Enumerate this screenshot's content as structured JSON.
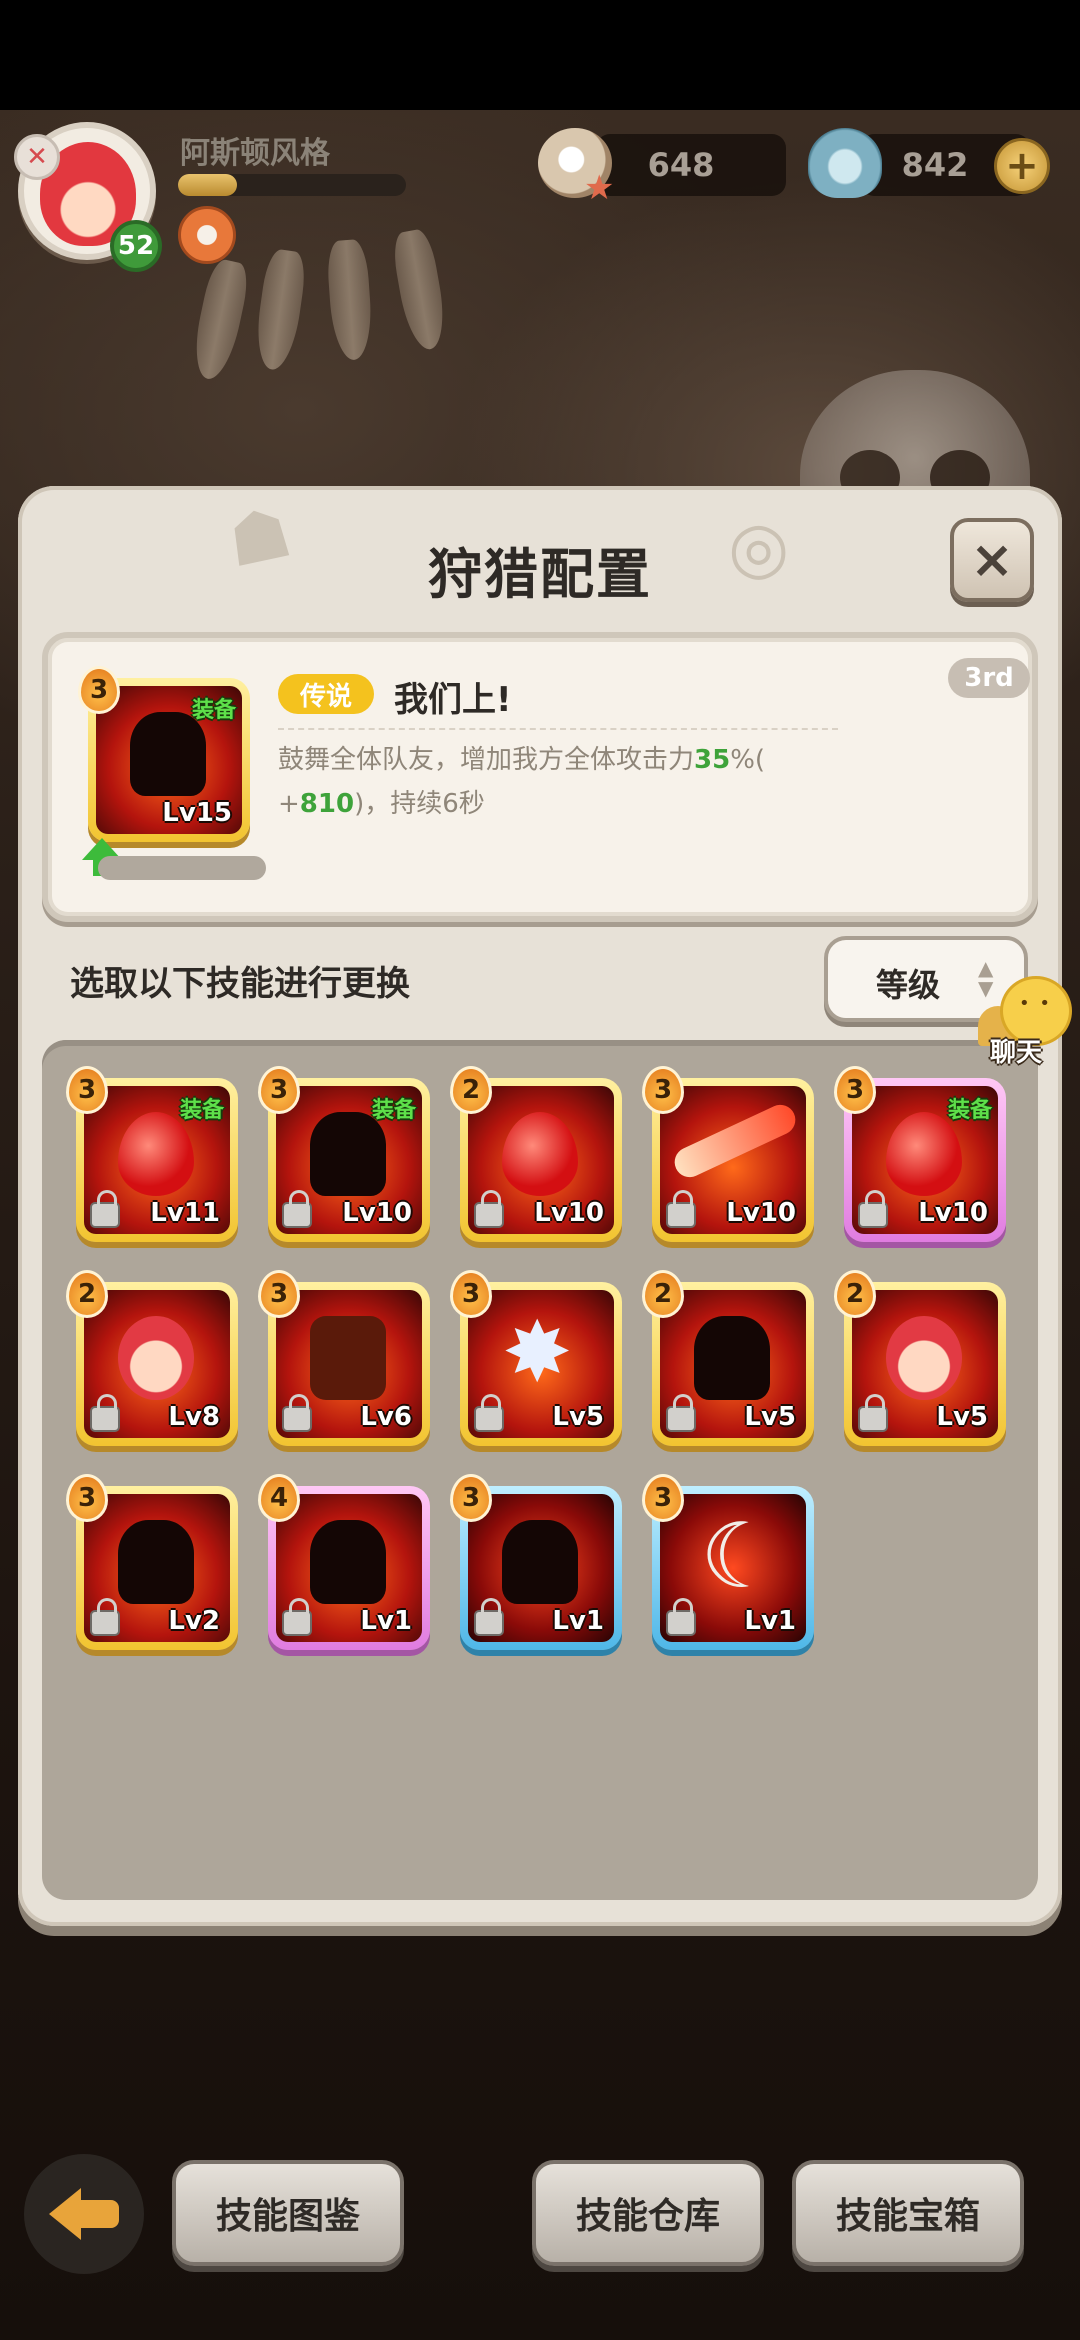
{
  "player": {
    "name": "阿斯顿风格",
    "level": "52",
    "xp_fraction": 0.26
  },
  "currencies": {
    "pearls": "648",
    "gems": "842",
    "add_label": "+"
  },
  "modal": {
    "title": "狩猎配置",
    "close_label": "×",
    "current_skill": {
      "cost": "3",
      "equipped_label": "装备",
      "level": "Lv15",
      "rank": "3rd",
      "rarity": "传说",
      "name": "我们上!",
      "desc_part1": "鼓舞全体队友，增加我方全体攻击力",
      "desc_highlight1": "35",
      "desc_part2": "%(",
      "desc_part3": "+",
      "desc_highlight2": "810",
      "desc_part4": ")，持续6秒",
      "upgrade_progress": 0.0
    },
    "section_heading": "选取以下技能进行更换",
    "sort": {
      "label": "等级"
    },
    "skills": [
      {
        "cost": "3",
        "level": "Lv11",
        "equipped": "装备",
        "frame": "gold",
        "art": "drop"
      },
      {
        "cost": "3",
        "level": "Lv10",
        "equipped": "装备",
        "frame": "gold",
        "art": "figure"
      },
      {
        "cost": "2",
        "level": "Lv10",
        "equipped": "",
        "frame": "gold",
        "art": "drop"
      },
      {
        "cost": "3",
        "level": "Lv10",
        "equipped": "",
        "frame": "gold",
        "art": "slash"
      },
      {
        "cost": "3",
        "level": "Lv10",
        "equipped": "装备",
        "frame": "purple",
        "art": "drop"
      },
      {
        "cost": "2",
        "level": "Lv8",
        "equipped": "",
        "frame": "gold",
        "art": "face"
      },
      {
        "cost": "3",
        "level": "Lv6",
        "equipped": "",
        "frame": "gold",
        "art": "fist"
      },
      {
        "cost": "3",
        "level": "Lv5",
        "equipped": "",
        "frame": "gold",
        "art": "star"
      },
      {
        "cost": "2",
        "level": "Lv5",
        "equipped": "",
        "frame": "gold",
        "art": "figure"
      },
      {
        "cost": "2",
        "level": "Lv5",
        "equipped": "",
        "frame": "gold",
        "art": "face"
      },
      {
        "cost": "3",
        "level": "Lv2",
        "equipped": "",
        "frame": "gold",
        "art": "figure"
      },
      {
        "cost": "4",
        "level": "Lv1",
        "equipped": "",
        "frame": "purple",
        "art": "figure"
      },
      {
        "cost": "3",
        "level": "Lv1",
        "equipped": "",
        "frame": "blue",
        "art": "figure"
      },
      {
        "cost": "3",
        "level": "Lv1",
        "equipped": "",
        "frame": "blue",
        "art": "blade"
      }
    ]
  },
  "chat": {
    "label": "聊天"
  },
  "bottom_bar": {
    "back_icon": "back-arrow-icon",
    "skill_codex": "技能图鉴",
    "skill_storage": "技能仓库",
    "skill_chest": "技能宝箱"
  },
  "colors": {
    "rarity_legend": "#f4c21e",
    "highlight_green": "#3ea33a",
    "equipped_green": "#5ee04a"
  }
}
